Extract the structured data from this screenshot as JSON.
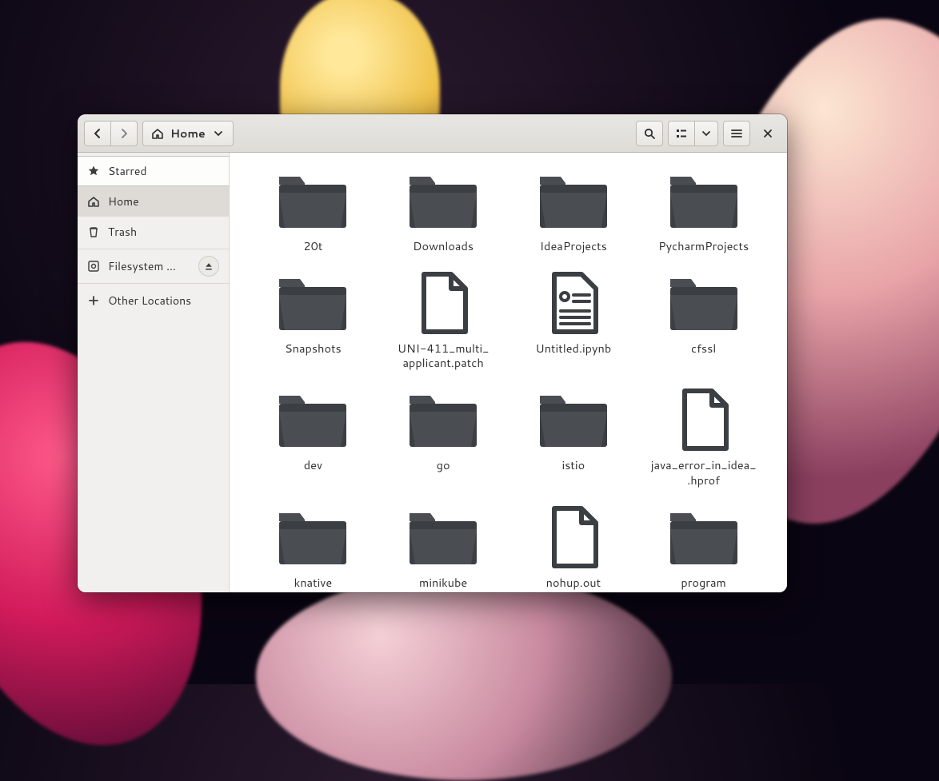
{
  "toolbar": {
    "path_label": "Home"
  },
  "sidebar": {
    "starred": "Starred",
    "home": "Home",
    "trash": "Trash",
    "fsroot": "Filesystem …",
    "other": "Other Locations"
  },
  "files": [
    {
      "name": "20t",
      "kind": "folder"
    },
    {
      "name": "Downloads",
      "kind": "folder"
    },
    {
      "name": "IdeaProjects",
      "kind": "folder"
    },
    {
      "name": "PycharmProjects",
      "kind": "folder"
    },
    {
      "name": "Snapshots",
      "kind": "folder"
    },
    {
      "name": "UNI-411_multi_\napplicant.patch",
      "kind": "file"
    },
    {
      "name": "Untitled.ipynb",
      "kind": "document"
    },
    {
      "name": "cfssl",
      "kind": "folder"
    },
    {
      "name": "dev",
      "kind": "folder"
    },
    {
      "name": "go",
      "kind": "folder"
    },
    {
      "name": "istio",
      "kind": "folder"
    },
    {
      "name": "java_error_in_idea_\n.hprof",
      "kind": "file"
    },
    {
      "name": "knative",
      "kind": "folder"
    },
    {
      "name": "minikube",
      "kind": "folder"
    },
    {
      "name": "nohup.out",
      "kind": "file"
    },
    {
      "name": "program",
      "kind": "folder"
    }
  ]
}
